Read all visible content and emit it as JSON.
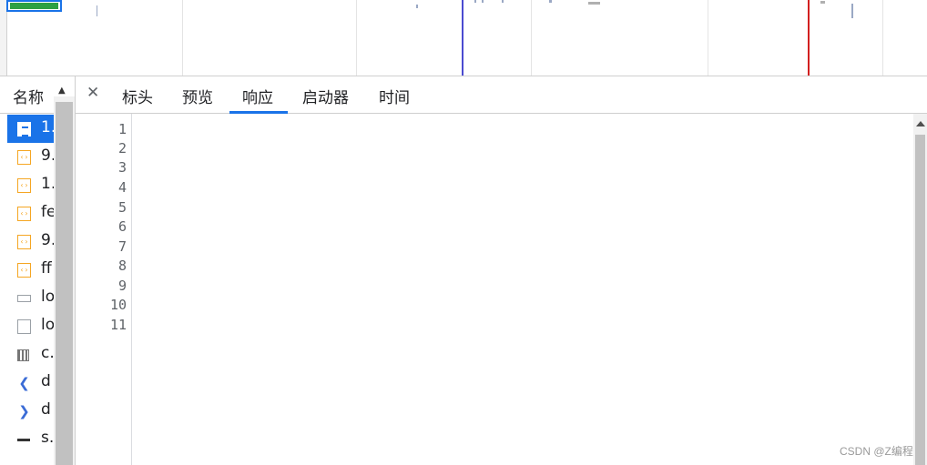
{
  "name_column": {
    "header": "名称",
    "sort_icon": "triangle-up-icon",
    "rows": [
      {
        "name": "1.",
        "icon": "document-icon",
        "selected": true
      },
      {
        "name": "9.",
        "icon": "script-icon"
      },
      {
        "name": "1.",
        "icon": "script-icon"
      },
      {
        "name": "fe",
        "icon": "script-icon"
      },
      {
        "name": "9.",
        "icon": "script-icon"
      },
      {
        "name": "ff",
        "icon": "script-icon"
      },
      {
        "name": "lo",
        "icon": "image-icon"
      },
      {
        "name": "lo",
        "icon": "image-icon"
      },
      {
        "name": "c.",
        "icon": "qr-image-icon"
      },
      {
        "name": "d",
        "icon": "arrow-left-icon"
      },
      {
        "name": "d",
        "icon": "arrow-right-icon"
      },
      {
        "name": "s.",
        "icon": "dash-image-icon"
      }
    ]
  },
  "tabs": {
    "close_icon": "close-icon",
    "items": [
      "标头",
      "预览",
      "响应",
      "启动器",
      "时间"
    ],
    "active": "响应"
  },
  "code": {
    "line_numbers": [
      "1",
      "2",
      "3",
      "4",
      "5",
      "6",
      "7",
      "8",
      "9",
      "10",
      "11"
    ]
  },
  "colors": {
    "accent": "#1a73e8",
    "tag": "#881280",
    "attr_name": "#994500",
    "attr_value": "#1a1aa6",
    "dom_content_loaded_marker": "#4b4bd0",
    "load_marker": "#d22020"
  },
  "watermark": "CSDN @Z编程"
}
